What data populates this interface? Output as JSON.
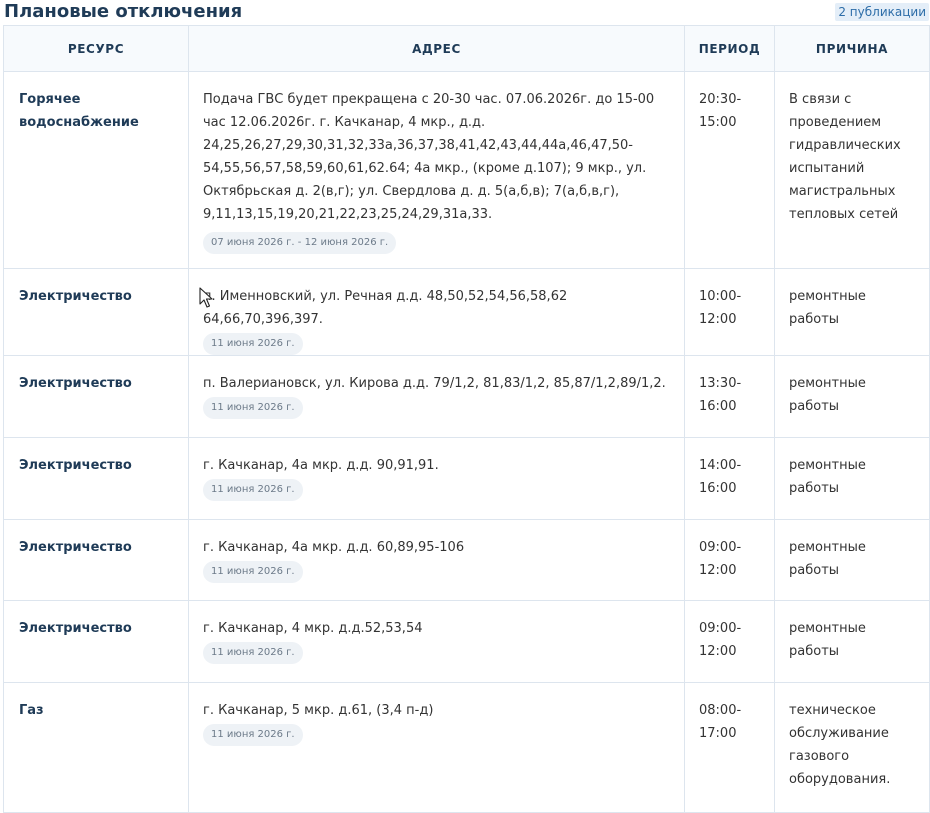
{
  "header": {
    "title": "Плановые отключения",
    "publications_badge": "2 публикации"
  },
  "table": {
    "columns": [
      "РЕСУРС",
      "АДРЕС",
      "ПЕРИОД",
      "ПРИЧИНА"
    ],
    "rows": [
      {
        "resource": "Горячее водоснабжение",
        "address": "Подача ГВС будет прекращена с 20-30 час. 07.06.2026г. до 15-00 час 12.06.2026г. г. Качканар, 4 мкр., д.д. 24,25,26,27,29,30,31,32,33а,36,37,38,41,42,43,44,44а,46,47,50-54,55,56,57,58,59,60,61,62.64; 4а мкр., (кроме д.107); 9 мкр., ул. Октябрьская д. 2(в,г); ул. Свердлова д. д. 5(а,б,в); 7(а,б,в,г), 9,11,13,15,19,20,21,22,23,25,24,29,31а,33.",
        "date": "07 июня 2026 г. - 12 июня 2026 г.",
        "period_start": "20:30-",
        "period_end": "15:00",
        "reason": "В связи с проведением гидравлических испытаний магистральных тепловых сетей"
      },
      {
        "resource": "Электричество",
        "address": "п. Именновский, ул. Речная д.д. 48,50,52,54,56,58,62 64,66,70,396,397.",
        "date": "11 июня 2026 г.",
        "period_start": "10:00-",
        "period_end": "12:00",
        "reason": "ремонтные работы"
      },
      {
        "resource": "Электричество",
        "address": "п. Валериановск, ул. Кирова д.д. 79/1,2, 81,83/1,2, 85,87/1,2,89/1,2.",
        "date": "11 июня 2026 г.",
        "period_start": "13:30-",
        "period_end": "16:00",
        "reason": "ремонтные работы"
      },
      {
        "resource": "Электричество",
        "address": "г. Качканар, 4а мкр. д.д. 90,91,91.",
        "date": "11 июня 2026 г.",
        "period_start": "14:00-",
        "period_end": "16:00",
        "reason": "ремонтные работы"
      },
      {
        "resource": "Электричество",
        "address": "г. Качканар, 4а мкр. д.д. 60,89,95-106",
        "date": "11 июня 2026 г.",
        "period_start": "09:00-",
        "period_end": "12:00",
        "reason": "ремонтные работы"
      },
      {
        "resource": "Электричество",
        "address": "г. Качканар, 4 мкр. д.д.52,53,54",
        "date": "11 июня 2026 г.",
        "period_start": "09:00-",
        "period_end": "12:00",
        "reason": "ремонтные работы"
      },
      {
        "resource": "Газ",
        "address": "г. Качканар, 5 мкр. д.61, (3,4 п-д)",
        "date": "11 июня 2026 г.",
        "period_start": "08:00-",
        "period_end": "17:00",
        "reason": "техническое обслуживание газового оборудования."
      }
    ]
  },
  "icons": {
    "cursor": "mouse-pointer-icon"
  },
  "colors": {
    "title": "#1f3b57",
    "badge_bg": "#e4eef8",
    "badge_text": "#2d6da8",
    "border": "#dde5ee",
    "pill_bg": "#eef2f6",
    "pill_text": "#6c7a89"
  }
}
